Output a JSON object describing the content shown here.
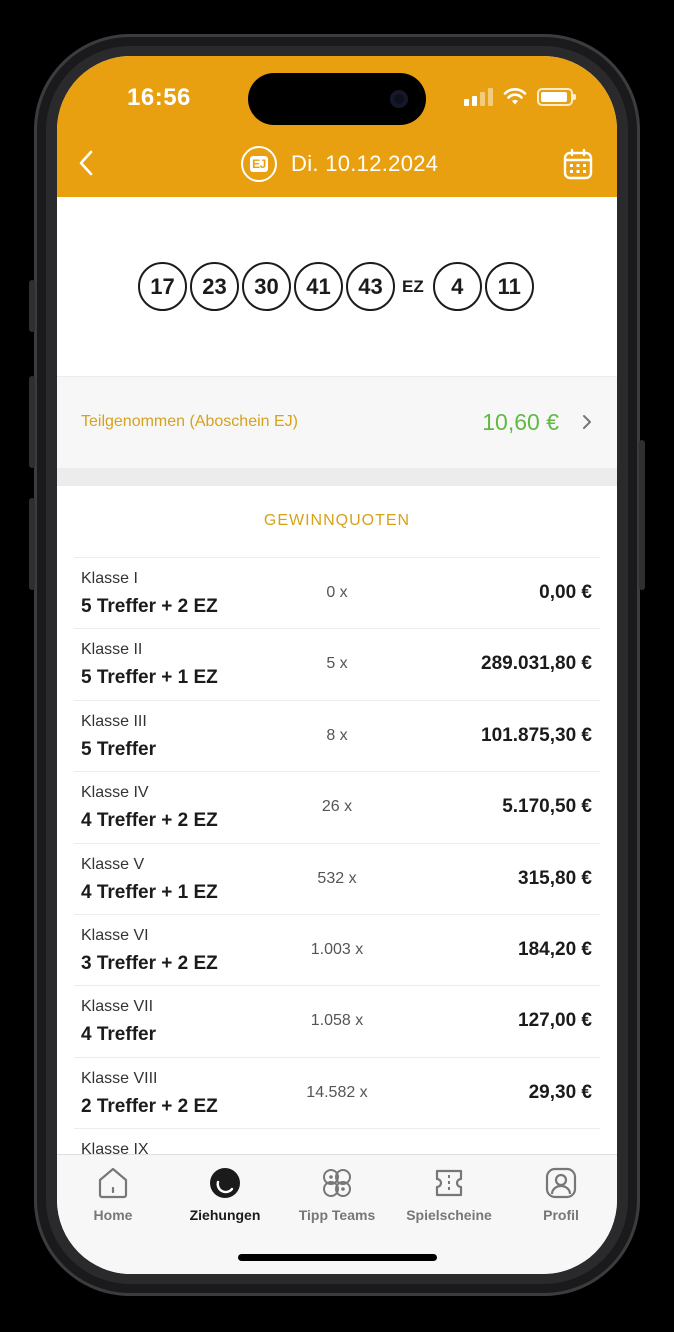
{
  "status_bar": {
    "time": "16:56"
  },
  "nav": {
    "date": "Di. 10.12.2024",
    "logo_text": "EJ"
  },
  "draw": {
    "main_numbers": [
      "17",
      "23",
      "30",
      "41",
      "43"
    ],
    "ez_label": "EZ",
    "euro_numbers": [
      "4",
      "11"
    ]
  },
  "participation": {
    "label": "Teilgenommen (Aboschein EJ)",
    "amount": "10,60 €"
  },
  "quoten": {
    "title": "GEWINNQUOTEN",
    "rows": [
      {
        "klasse": "Klasse I",
        "treffer": "5 Treffer + 2 EZ",
        "count": "0 x",
        "payout": "0,00 €"
      },
      {
        "klasse": "Klasse II",
        "treffer": "5 Treffer + 1 EZ",
        "count": "5 x",
        "payout": "289.031,80 €"
      },
      {
        "klasse": "Klasse III",
        "treffer": "5 Treffer",
        "count": "8 x",
        "payout": "101.875,30 €"
      },
      {
        "klasse": "Klasse IV",
        "treffer": "4 Treffer + 2 EZ",
        "count": "26 x",
        "payout": "5.170,50 €"
      },
      {
        "klasse": "Klasse V",
        "treffer": "4 Treffer + 1 EZ",
        "count": "532 x",
        "payout": "315,80 €"
      },
      {
        "klasse": "Klasse VI",
        "treffer": "3 Treffer + 2 EZ",
        "count": "1.003 x",
        "payout": "184,20 €"
      },
      {
        "klasse": "Klasse VII",
        "treffer": "4 Treffer",
        "count": "1.058 x",
        "payout": "127,00 €"
      },
      {
        "klasse": "Klasse VIII",
        "treffer": "2 Treffer + 2 EZ",
        "count": "14.582 x",
        "payout": "29,30 €"
      },
      {
        "klasse": "Klasse IX",
        "treffer": "",
        "count": "",
        "payout": ""
      }
    ]
  },
  "tabbar": {
    "tabs": [
      {
        "label": "Home",
        "icon": "home-icon"
      },
      {
        "label": "Ziehungen",
        "icon": "draws-icon",
        "active": true
      },
      {
        "label": "Tipp Teams",
        "icon": "team-icon"
      },
      {
        "label": "Spielscheine",
        "icon": "ticket-icon"
      },
      {
        "label": "Profil",
        "icon": "profile-icon"
      }
    ]
  },
  "colors": {
    "header": "#e9a010",
    "accent_text": "#d6a21c",
    "amount_green": "#63b946"
  }
}
